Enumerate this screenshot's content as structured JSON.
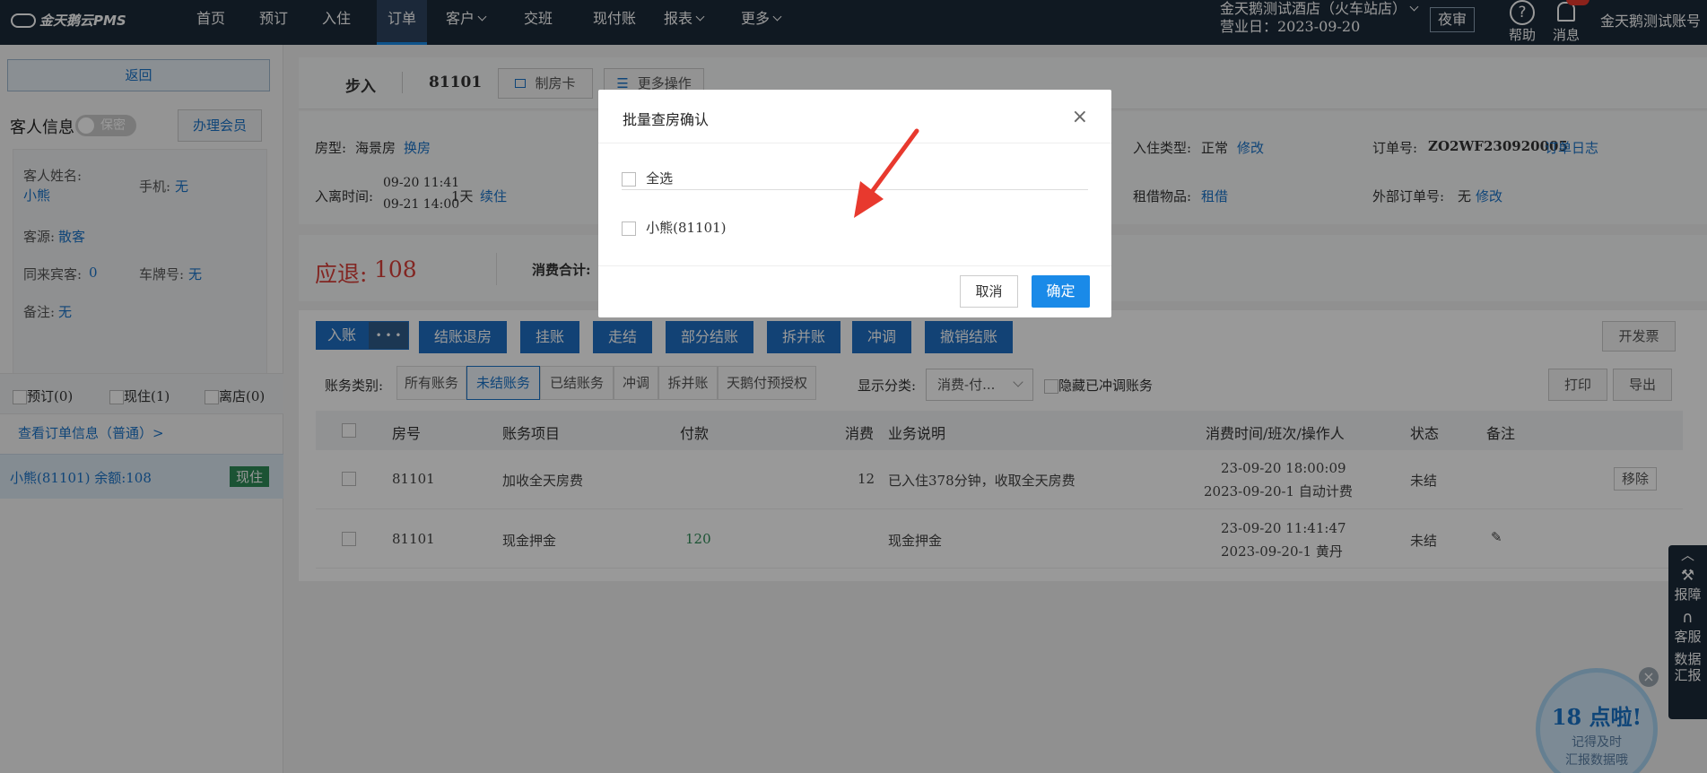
{
  "topbar": {
    "logo": "金天鹅云PMS",
    "nav": [
      {
        "label": "首页",
        "caret": false
      },
      {
        "label": "预订",
        "caret": false
      },
      {
        "label": "入住",
        "caret": false
      },
      {
        "label": "订单",
        "caret": false,
        "active": true
      },
      {
        "label": "客户",
        "caret": true
      },
      {
        "label": "交班",
        "caret": false
      },
      {
        "label": "现付账",
        "caret": false
      },
      {
        "label": "报表",
        "caret": true
      },
      {
        "label": "更多",
        "caret": true
      }
    ],
    "hotel_name": "金天鹅测试酒店（火车站店）",
    "business_date": "营业日：2023-09-20",
    "night_audit": "夜审",
    "help": "帮助",
    "messages": "消息",
    "account": "金天鹅测试账号"
  },
  "sidebar": {
    "back": "返回",
    "guest_info_title": "客人信息",
    "privacy_toggle": "保密",
    "member_button": "办理会员",
    "guest_name_label": "客人姓名:",
    "guest_name": "小熊",
    "phone_label": "手机:",
    "phone": "无",
    "source_label": "客源:",
    "source": "散客",
    "companions_label": "同来宾客:",
    "companions": "0",
    "plate_label": "车牌号:",
    "plate": "无",
    "remark_label": "备注:",
    "remark": "无",
    "filters": [
      "预订(0)",
      "现住(1)",
      "离店(0)"
    ],
    "order_link": "查看订单信息（普通）>",
    "room_item": "小熊(81101)  余额:108",
    "room_status": "现住"
  },
  "order": {
    "status": "步入",
    "room_no": "81101",
    "make_card": "制房卡",
    "more_ops": "更多操作",
    "room_type_label": "房型:",
    "room_type": "海景房",
    "change_room": "换房",
    "checkin_type_label": "入住类型:",
    "checkin_type": "正常",
    "modify": "修改",
    "order_no_label": "订单号:",
    "order_no": "ZO2WF230920005",
    "order_log": "订单日志",
    "stay_label": "入离时间:",
    "arrive": "09-20 11:41",
    "depart": "09-21 14:00",
    "nights": "1天",
    "extend": "续住",
    "rental_label": "租借物品:",
    "rental": "租借",
    "ext_order_label": "外部订单号:",
    "ext_order": "无",
    "ext_modify": "修改",
    "refund_label": "应退:",
    "refund_value": "108",
    "consume_total_label": "消费合计:"
  },
  "actions": {
    "post": "入账",
    "more": "• • •",
    "buttons": [
      "结账退房",
      "挂账",
      "走结",
      "部分结账",
      "拆并账",
      "冲调",
      "撤销结账"
    ],
    "invoice": "开发票",
    "print": "打印",
    "export": "导出"
  },
  "filters": {
    "category_label": "账务类别:",
    "tabs": [
      "所有账务",
      "未结账务",
      "已结账务",
      "冲调",
      "拆并账",
      "天鹅付预授权"
    ],
    "active_tab": 1,
    "display_label": "显示分类:",
    "display_value": "消费-付...",
    "hide_reversed": "隐藏已冲调账务"
  },
  "table": {
    "headers": [
      "房号",
      "账务项目",
      "付款",
      "消费",
      "业务说明",
      "消费时间/班次/操作人",
      "状态",
      "备注"
    ],
    "rows": [
      {
        "room": "81101",
        "item": "加收全天房费",
        "pay": "",
        "consume": "12",
        "desc": "已入住378分钟，收取全天房费",
        "time1": "23-09-20 18:00:09",
        "time2": "2023-09-20-1 自动计费",
        "status": "未结",
        "remark": "",
        "action": "移除"
      },
      {
        "room": "81101",
        "item": "现金押金",
        "pay": "120",
        "consume": "",
        "desc": "现金押金",
        "time1": "23-09-20 11:41:47",
        "time2": "2023-09-20-1 黄丹",
        "status": "未结",
        "remark": "✎",
        "action": ""
      }
    ]
  },
  "modal": {
    "title": "批量查房确认",
    "select_all": "全选",
    "guest_option": "小熊(81101)",
    "cancel": "取消",
    "confirm": "确定"
  },
  "tools": {
    "report_fault": "报障",
    "service": "客服",
    "data_report": "数据汇报"
  },
  "promo": {
    "headline": "18 点啦!",
    "line1": "记得及时",
    "line2": "汇报数据哦"
  },
  "colors": {
    "nav_bg": "#1b2a3a",
    "primary": "#1f6fc4",
    "refund": "#d9403a",
    "status_green": "#2e8b57",
    "arrow": "#e8392e"
  }
}
